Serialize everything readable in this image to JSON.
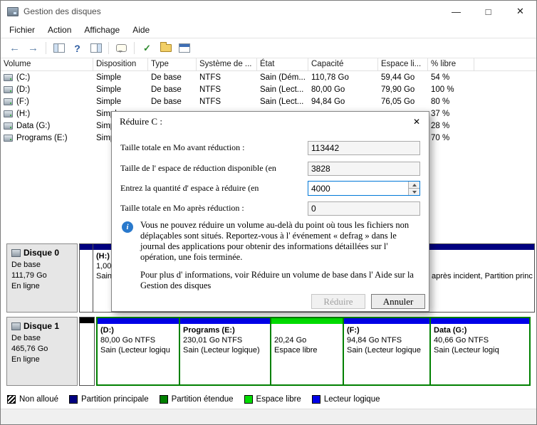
{
  "window": {
    "title": "Gestion des disques"
  },
  "icons": {
    "minimize": "—",
    "maximize": "□",
    "close": "✕",
    "back": "←",
    "forward": "→",
    "help": "?",
    "check": "✓",
    "info": "i"
  },
  "menu": {
    "items": [
      "Fichier",
      "Action",
      "Affichage",
      "Aide"
    ]
  },
  "toolbar": {
    "icons": [
      "back-icon",
      "forward-icon",
      "console-tree-icon",
      "help-icon",
      "action-pane-icon",
      "popup-help-icon",
      "check-icon",
      "folder-icon",
      "console-window-icon"
    ]
  },
  "volume_table": {
    "columns": [
      "Volume",
      "Disposition",
      "Type",
      "Système de ...",
      "État",
      "Capacité",
      "Espace li...",
      "% libre"
    ],
    "column_keys": [
      "volume",
      "disposition",
      "type",
      "fs",
      "etat",
      "capacite",
      "espace",
      "libre"
    ],
    "rows": [
      {
        "volume": "(C:)",
        "disposition": "Simple",
        "type": "De base",
        "fs": "NTFS",
        "etat": "Sain (Dém...",
        "capacite": "110,78 Go",
        "espace": "59,44 Go",
        "libre": "54 %"
      },
      {
        "volume": "(D:)",
        "disposition": "Simple",
        "type": "De base",
        "fs": "NTFS",
        "etat": "Sain (Lect...",
        "capacite": "80,00 Go",
        "espace": "79,90 Go",
        "libre": "100 %"
      },
      {
        "volume": "(F:)",
        "disposition": "Simple",
        "type": "De base",
        "fs": "NTFS",
        "etat": "Sain (Lect...",
        "capacite": "94,84 Go",
        "espace": "76,05 Go",
        "libre": "80 %"
      },
      {
        "volume": "(H:)",
        "disposition": "Simple",
        "type": "",
        "fs": "",
        "etat": "",
        "capacite": "",
        "espace": "",
        "libre": "37 %"
      },
      {
        "volume": "Data (G:)",
        "disposition": "Simple",
        "type": "",
        "fs": "",
        "etat": "",
        "capacite": "",
        "espace": "",
        "libre": "28 %"
      },
      {
        "volume": "Programs (E:)",
        "disposition": "Simple",
        "type": "",
        "fs": "",
        "etat": "",
        "capacite": "",
        "espace": "",
        "libre": "70 %"
      }
    ]
  },
  "disks": [
    {
      "name": "Disque 0",
      "type": "De base",
      "size": "111,79 Go",
      "status": "En ligne",
      "partitions": [
        {
          "kind": "primary",
          "label": "",
          "size": "",
          "status": ""
        },
        {
          "kind": "primary",
          "label": "(H:)",
          "size": "1,00 Go",
          "status": "Sain (S"
        },
        {
          "kind": "primary",
          "label": "",
          "size": "",
          "status": "après incident, Partition princ"
        }
      ]
    },
    {
      "name": "Disque 1",
      "type": "De base",
      "size": "465,76 Go",
      "status": "En ligne",
      "leading_partitions": [
        {
          "kind": "unallocated",
          "label": "",
          "size": "",
          "status": ""
        }
      ],
      "extended_partitions": [
        {
          "kind": "logical",
          "label": "(D:)",
          "size": "80,00 Go NTFS",
          "status": "Sain (Lecteur logiqu"
        },
        {
          "kind": "logical",
          "label": "Programs (E:)",
          "size": "230,01 Go NTFS",
          "status": "Sain (Lecteur logique)"
        },
        {
          "kind": "free",
          "label": "",
          "size": "20,24 Go",
          "status": "Espace libre"
        },
        {
          "kind": "logical",
          "label": "(F:)",
          "size": "94,84 Go NTFS",
          "status": "Sain (Lecteur logique"
        },
        {
          "kind": "logical",
          "label": "Data (G:)",
          "size": "40,66 Go NTFS",
          "status": "Sain (Lecteur logiq"
        }
      ]
    }
  ],
  "legend": {
    "items": [
      {
        "key": "unallocated",
        "label": "Non alloué",
        "color": "#000000",
        "hatch": true
      },
      {
        "key": "primary",
        "label": "Partition principale",
        "color": "#000080"
      },
      {
        "key": "extended",
        "label": "Partition étendue",
        "color": "#008000"
      },
      {
        "key": "free",
        "label": "Espace libre",
        "color": "#00DC00"
      },
      {
        "key": "logical",
        "label": "Lecteur logique",
        "color": "#0000E8"
      }
    ]
  },
  "dialog": {
    "title": "Réduire C :",
    "fields": [
      {
        "label": "Taille totale en Mo avant réduction  :",
        "value": "113442",
        "editable": false
      },
      {
        "label": "Taille de l' espace de réduction disponible (en",
        "value": "3828",
        "editable": false
      },
      {
        "label": "Entrez la quantité d' espace à réduire (en",
        "value": "4000",
        "editable": true
      },
      {
        "label": "Taille totale en Mo après réduction  :",
        "value": "0",
        "editable": false
      }
    ],
    "info_text": "Vous ne pouvez réduire un volume au-delà du point où tous les fichiers non déplaçables sont situés. Reportez-vous à l' événement « defrag » dans le journal des applications pour obtenir des informations détaillées sur l' opération, une fois terminée.",
    "help_text": "Pour plus d' informations, voir Réduire un volume de base dans l' Aide sur la Gestion des disques",
    "shrink_label": "Réduire",
    "cancel_label": "Annuler"
  }
}
